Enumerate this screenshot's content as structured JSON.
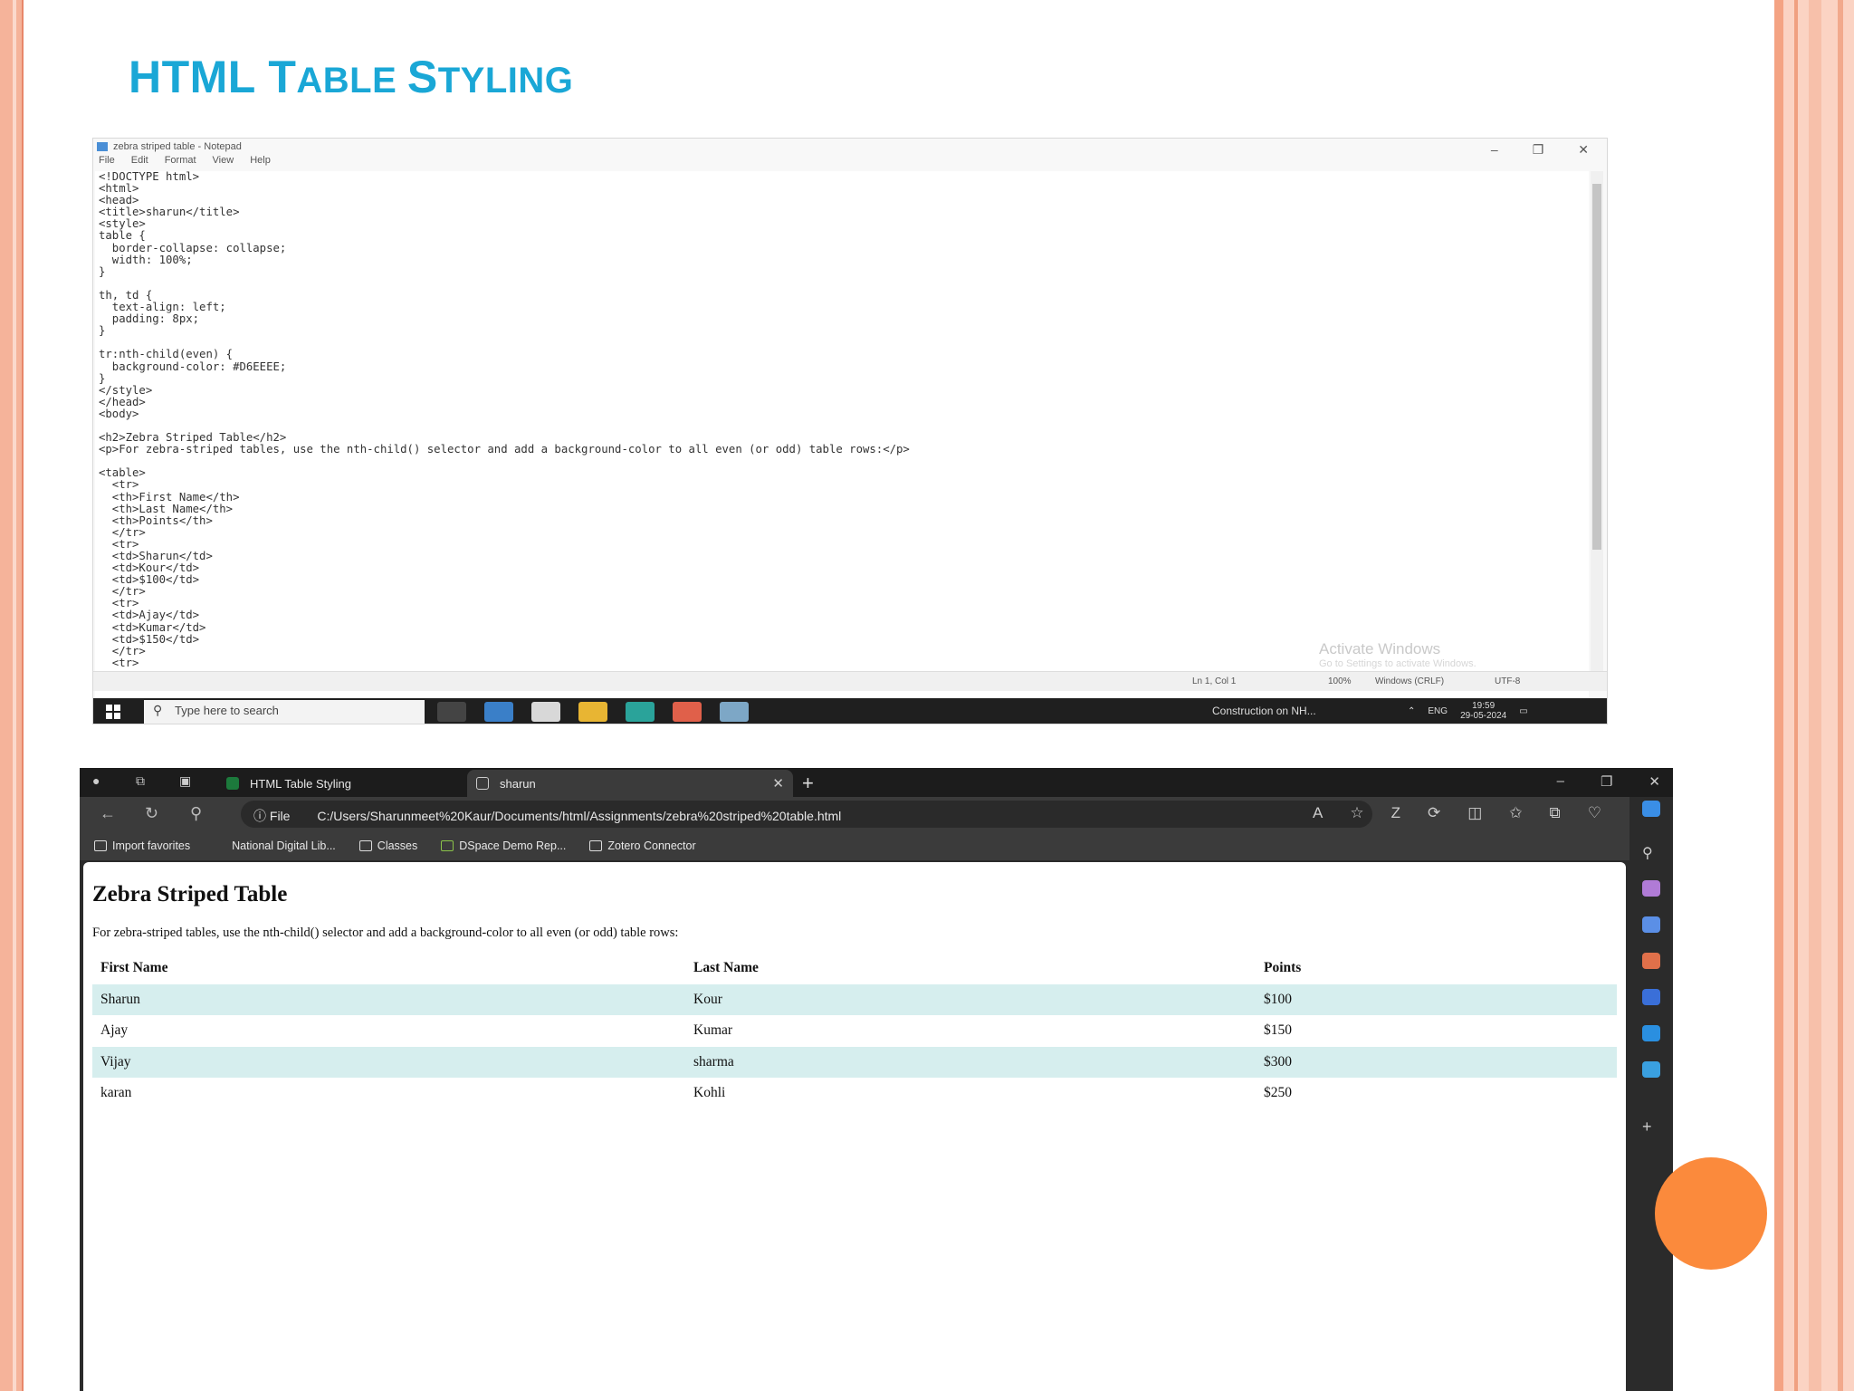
{
  "slide": {
    "title_main": "HTML T",
    "title_sc1": "ABLE ",
    "title_s": "S",
    "title_sc2": "TYLING"
  },
  "notepad": {
    "window_title": "zebra striped table - Notepad",
    "menu": [
      "File",
      "Edit",
      "Format",
      "View",
      "Help"
    ],
    "code": "<!DOCTYPE html>\n<html>\n<head>\n<title>sharun</title>\n<style>\ntable {\n  border-collapse: collapse;\n  width: 100%;\n}\n\nth, td {\n  text-align: left;\n  padding: 8px;\n}\n\ntr:nth-child(even) {\n  background-color: #D6EEEE;\n}\n</style>\n</head>\n<body>\n\n<h2>Zebra Striped Table</h2>\n<p>For zebra-striped tables, use the nth-child() selector and add a background-color to all even (or odd) table rows:</p>\n\n<table>\n  <tr>\n  <th>First Name</th>\n  <th>Last Name</th>\n  <th>Points</th>\n  </tr>\n  <tr>\n  <td>Sharun</td>\n  <td>Kour</td>\n  <td>$100</td>\n  </tr>\n  <tr>\n  <td>Ajay</td>\n  <td>Kumar</td>\n  <td>$150</td>\n  </tr>\n  <tr>",
    "watermark_title": "Activate Windows",
    "watermark_sub": "Go to Settings to activate Windows.",
    "status": {
      "position": "Ln 1, Col 1",
      "zoom": "100%",
      "eol": "Windows (CRLF)",
      "encoding": "UTF-8"
    },
    "taskbar": {
      "search_placeholder": "Type here to search",
      "news": "Construction on NH...",
      "lang": "ENG",
      "time": "19:59",
      "date": "29-05-2024"
    }
  },
  "browser": {
    "tabs": [
      {
        "title": "HTML Table Styling",
        "active": false
      },
      {
        "title": "sharun",
        "active": true
      }
    ],
    "url_label": "File",
    "url": "C:/Users/Sharunmeet%20Kaur/Documents/html/Assignments/zebra%20striped%20table.html",
    "favorites": [
      "Import favorites",
      "National Digital Lib...",
      "Classes",
      "DSpace Demo Rep...",
      "Zotero Connector"
    ],
    "page": {
      "heading": "Zebra Striped Table",
      "intro": "For zebra-striped tables, use the nth-child() selector and add a background-color to all even (or odd) table rows:",
      "columns": [
        "First Name",
        "Last Name",
        "Points"
      ],
      "rows": [
        [
          "Sharun",
          "Kour",
          "$100"
        ],
        [
          "Ajay",
          "Kumar",
          "$150"
        ],
        [
          "Vijay",
          "sharma",
          "$300"
        ],
        [
          "karan",
          "Kohli",
          "$250"
        ]
      ],
      "stripe_color": "#D6EEEE"
    }
  }
}
